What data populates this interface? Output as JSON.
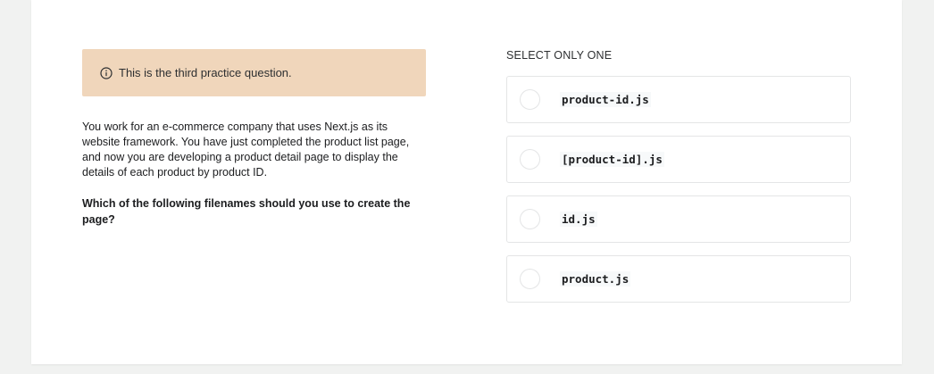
{
  "banner": {
    "text": "This is the third practice question.",
    "icon": "info-icon"
  },
  "question": {
    "body": "You work for an e-commerce company that uses Next.js as its website framework. You have just completed the product list page, and now you are developing a product detail page to display the details of each product by product ID.",
    "prompt": "Which of the following filenames should you use to create the page?"
  },
  "answers": {
    "select_label": "SELECT ONLY ONE",
    "options": [
      {
        "label": "product-id.js"
      },
      {
        "label": "[product-id].js"
      },
      {
        "label": "id.js"
      },
      {
        "label": "product.js"
      }
    ]
  },
  "colors": {
    "page_background": "#f1f2f1",
    "card_background": "#ffffff",
    "banner_background": "#f0d6bb",
    "option_border": "#e4e5e6"
  }
}
